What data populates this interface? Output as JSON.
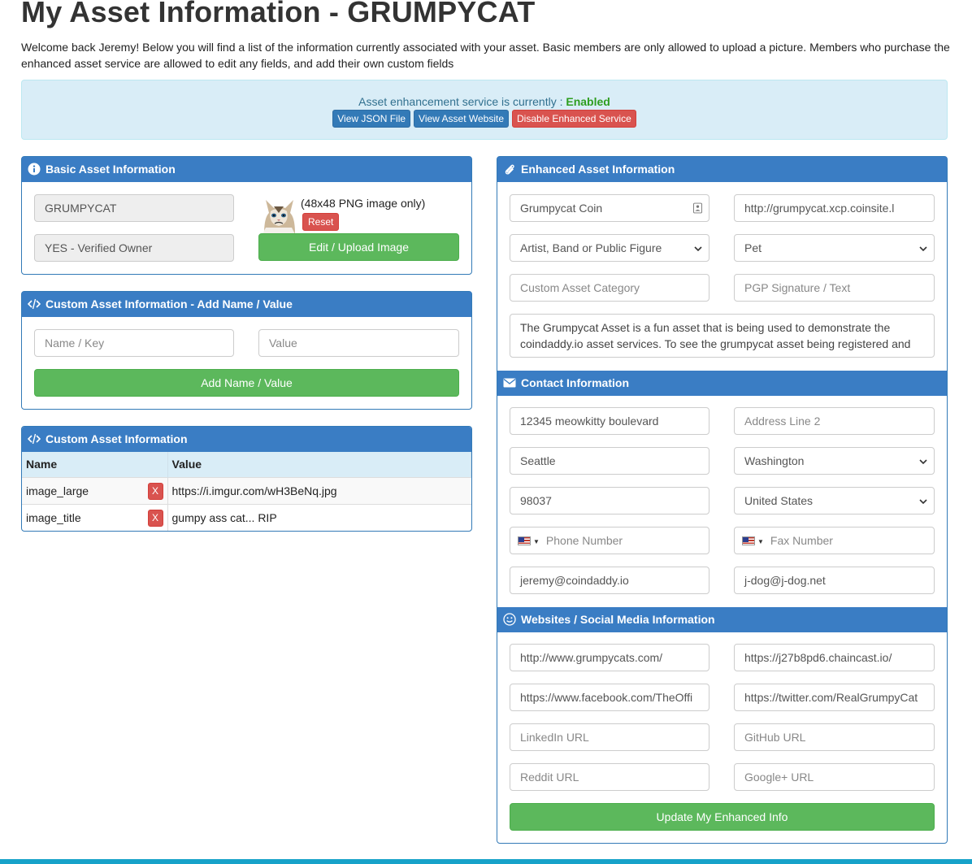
{
  "page": {
    "title": "My Asset Information - GRUMPYCAT",
    "intro": "Welcome back Jeremy! Below you will find a list of the information currently associated with your asset. Basic members are only allowed to upload a picture. Members who purchase the enhanced asset service are allowed to edit any fields, and add their own custom fields"
  },
  "alert": {
    "status_label": "Asset enhancement service is currently : ",
    "status_value": "Enabled",
    "view_json_label": "View JSON File",
    "view_website_label": "View Asset Website",
    "disable_label": "Disable Enhanced Service"
  },
  "basic": {
    "title": "Basic Asset Information",
    "asset_name": "GRUMPYCAT",
    "owner_status": "YES - Verified Owner",
    "image_note": "(48x48 PNG image only)",
    "reset_label": "Reset",
    "upload_label": "Edit / Upload Image"
  },
  "custom_add": {
    "title": "Custom Asset Information - Add Name / Value",
    "name_placeholder": "Name / Key",
    "value_placeholder": "Value",
    "add_label": "Add Name / Value"
  },
  "custom_list": {
    "title": "Custom Asset Information",
    "col_name": "Name",
    "col_value": "Value",
    "delete_label": "X",
    "rows": [
      {
        "name": "image_large",
        "value": "https://i.imgur.com/wH3BeNq.jpg"
      },
      {
        "name": "image_title",
        "value": "gumpy ass cat... RIP"
      }
    ]
  },
  "enhanced": {
    "title": "Enhanced Asset Information",
    "asset_title": "Grumpycat Coin",
    "asset_url": "http://grumpycat.xcp.coinsite.l",
    "category_1": "Artist, Band or Public Figure",
    "category_2": "Pet",
    "custom_category_placeholder": "Custom Asset Category",
    "pgp_placeholder": "PGP Signature / Text",
    "description": "The Grumpycat Asset  is a fun asset that is being used to demonstrate the coindaddy.io asset services. To see the grumpycat asset being registered and"
  },
  "contact": {
    "title": "Contact Information",
    "address1": "12345 meowkitty boulevard",
    "address2_placeholder": "Address Line 2",
    "city": "Seattle",
    "state": "Washington",
    "zip": "98037",
    "country": "United States",
    "phone_placeholder": "Phone Number",
    "fax_placeholder": "Fax Number",
    "email1": "jeremy@coindaddy.io",
    "email2": "j-dog@j-dog.net"
  },
  "social": {
    "title": "Websites / Social Media Information",
    "website1": "http://www.grumpycats.com/",
    "website2": "https://j27b8pd6.chaincast.io/",
    "facebook": "https://www.facebook.com/TheOffi",
    "twitter": "https://twitter.com/RealGrumpyCat",
    "linkedin_placeholder": "LinkedIn URL",
    "github_placeholder": "GitHub URL",
    "reddit_placeholder": "Reddit URL",
    "google_placeholder": "Google+ URL",
    "update_label": "Update My Enhanced Info"
  },
  "colors": {
    "panel_header": "#3a7dc4",
    "success": "#5cb85c",
    "danger": "#d9534f",
    "alert_bg": "#d9edf7"
  }
}
